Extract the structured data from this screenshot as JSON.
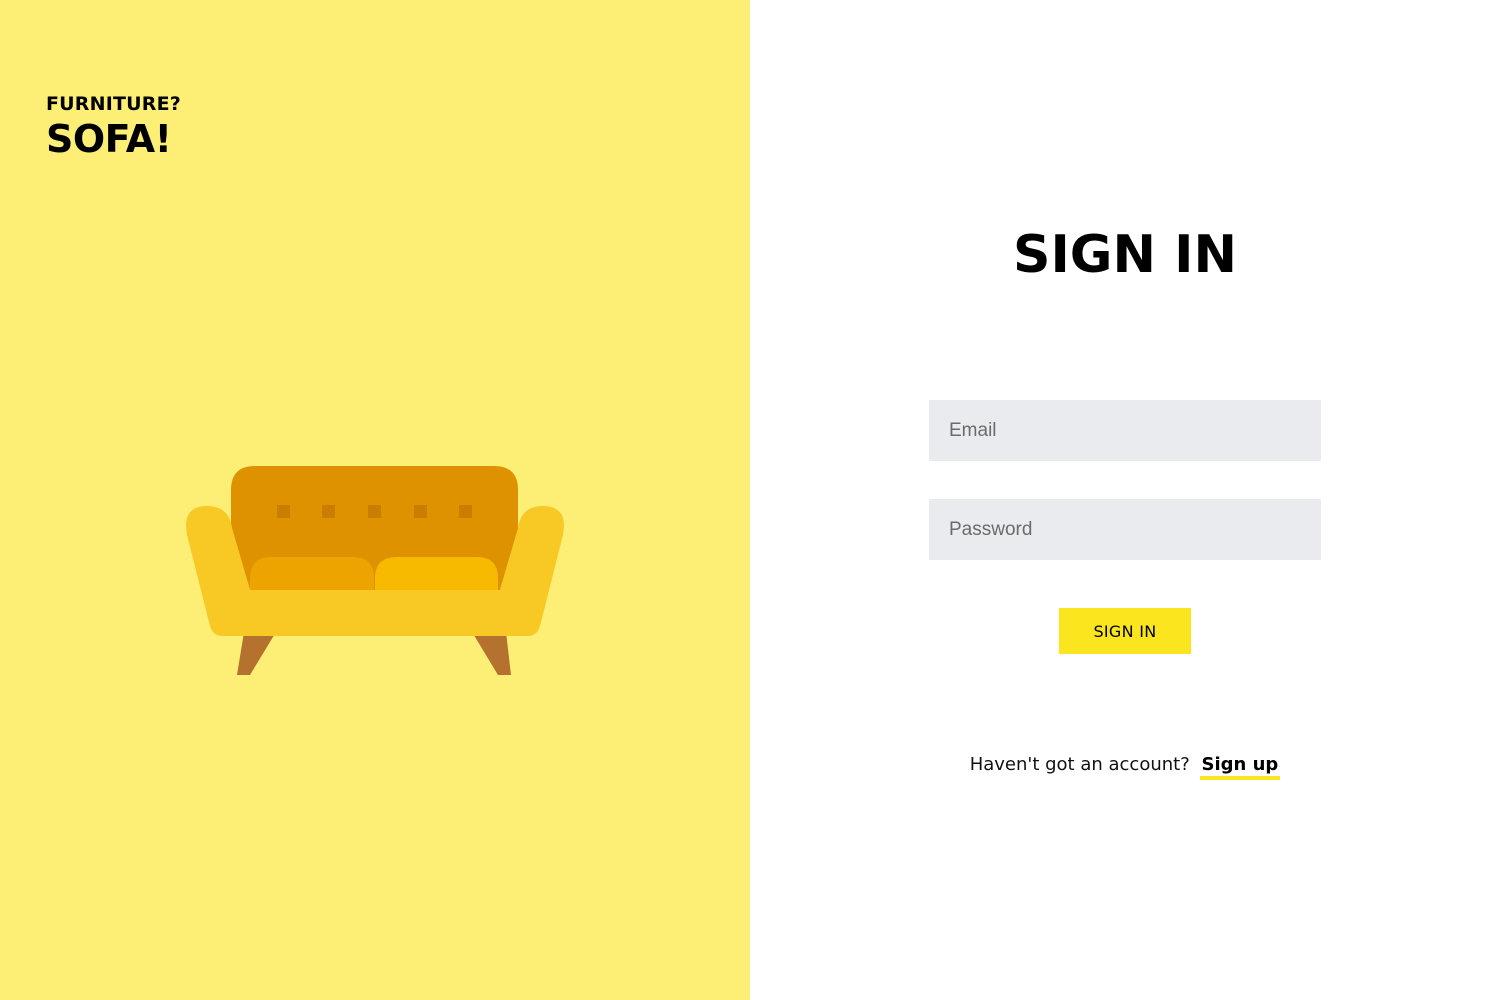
{
  "brand": {
    "tagline": "FURNITURE?",
    "name": "SOFA!"
  },
  "illustration": {
    "icon": "sofa-icon"
  },
  "signin": {
    "title": "SIGN IN",
    "email_placeholder": "Email",
    "email_value": "",
    "password_placeholder": "Password",
    "password_value": "",
    "button_label": "SIGN IN"
  },
  "signup": {
    "prompt": "Haven't got an account?",
    "link_label": "Sign up"
  },
  "colors": {
    "left_panel_bg": "#fdef76",
    "accent": "#fae51f",
    "input_bg": "#e9ebee",
    "sofa_body": "#f8c825",
    "sofa_back": "#de9200",
    "sofa_leg": "#b5722f"
  }
}
